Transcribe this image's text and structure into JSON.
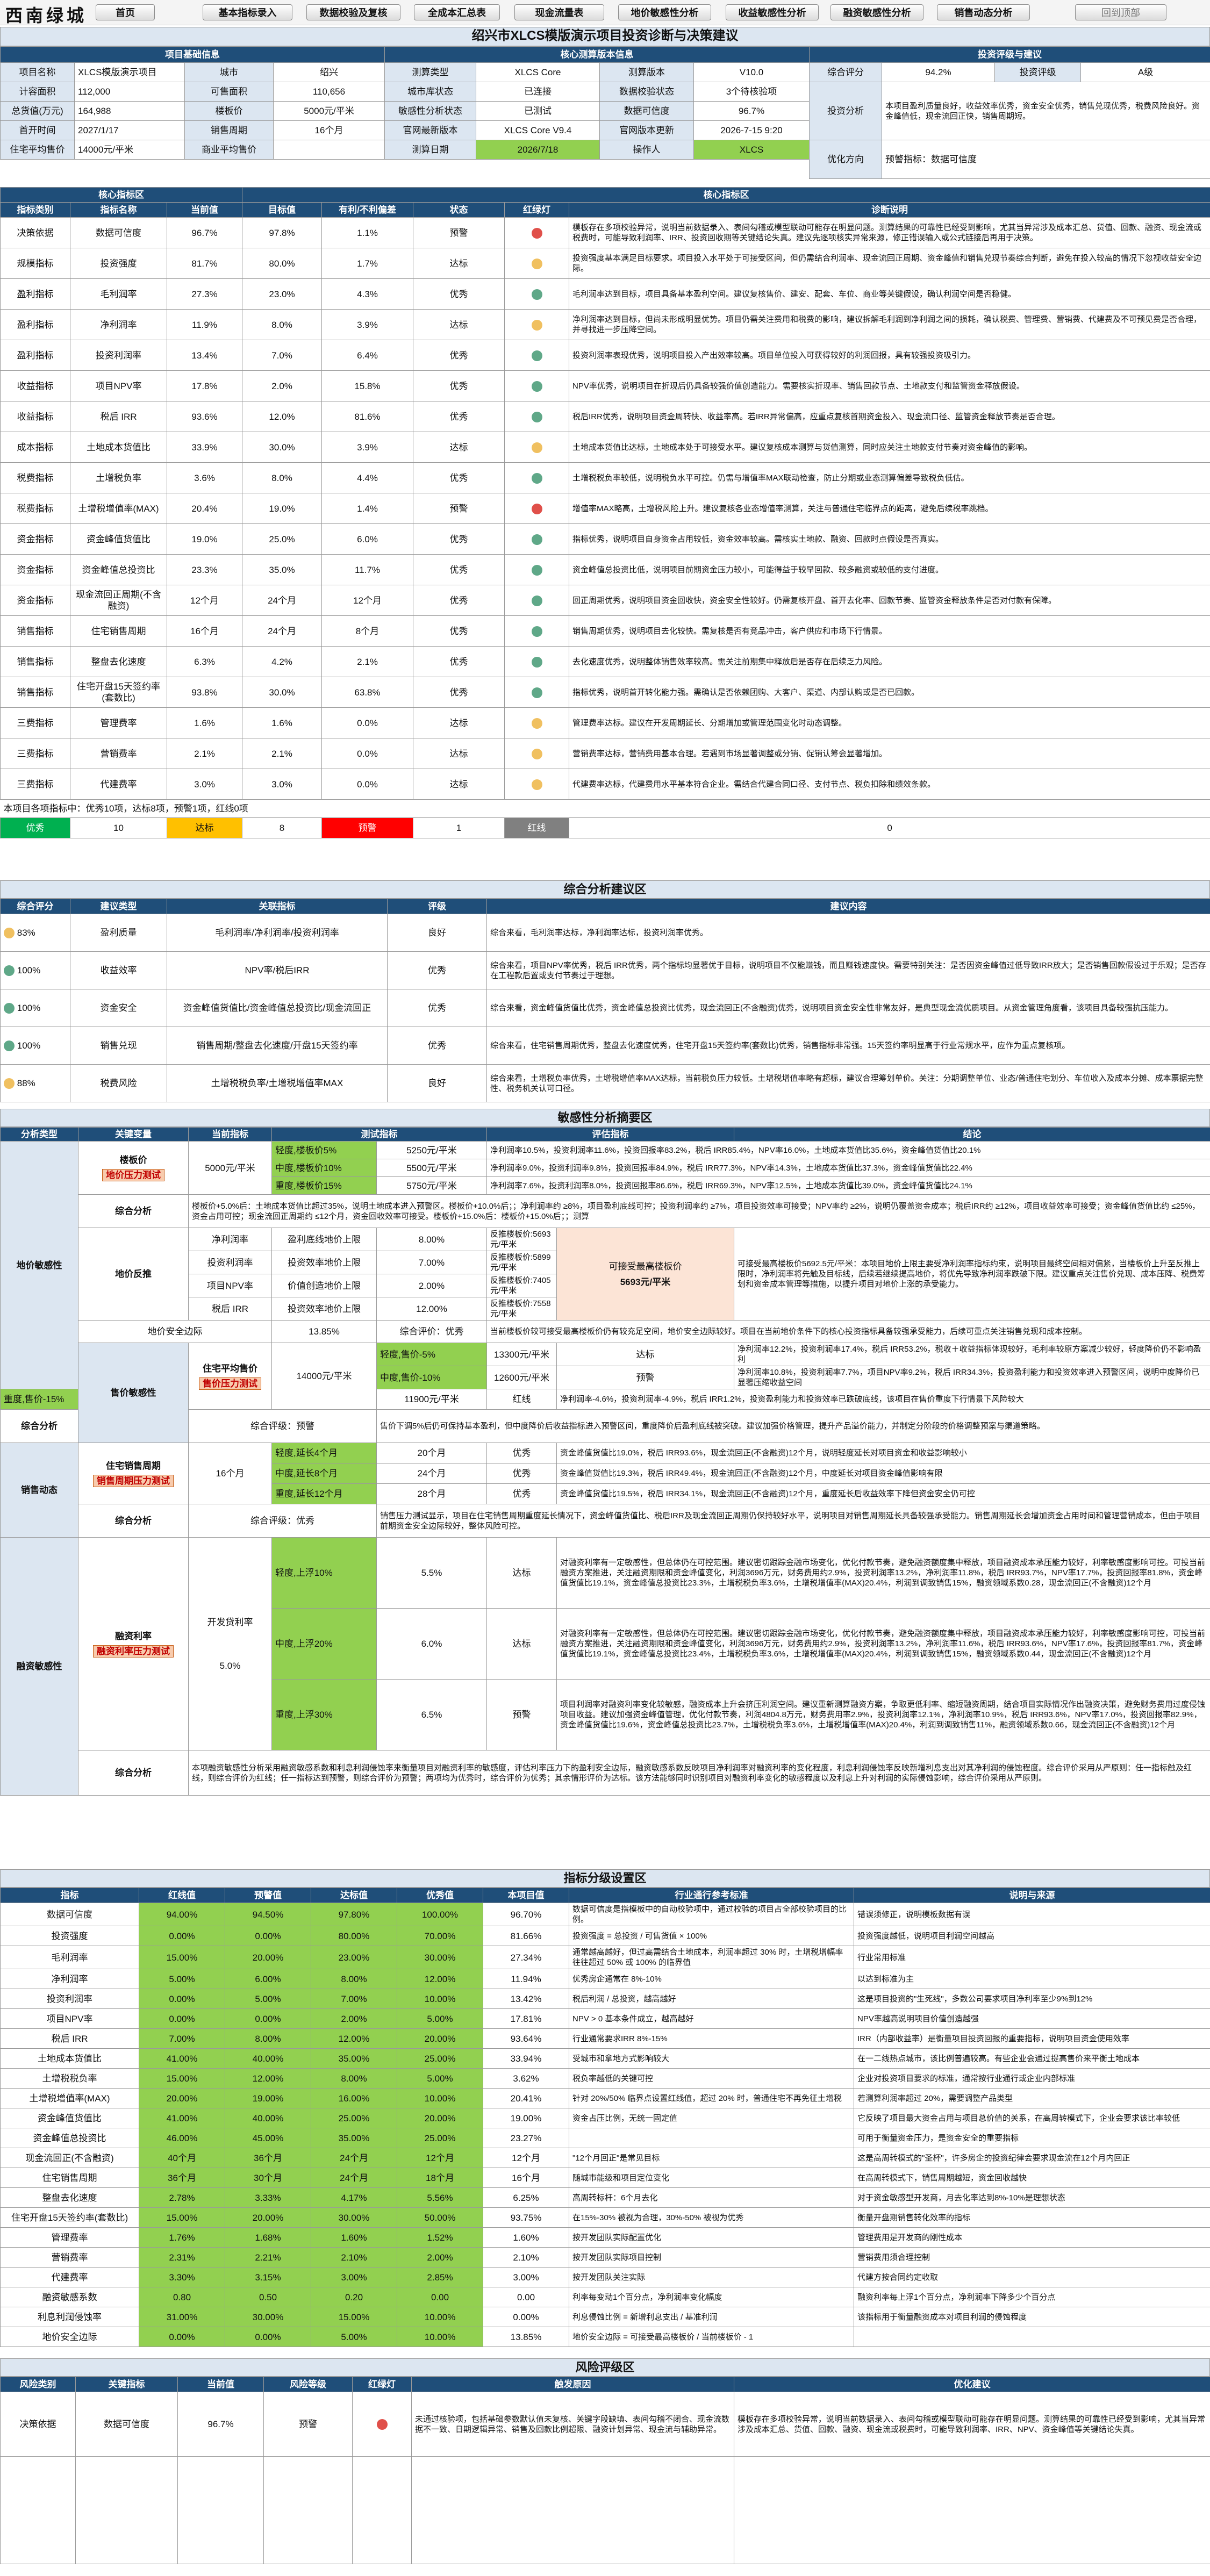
{
  "app": {
    "logo": "西南绿城"
  },
  "nav": [
    "首页",
    "基本指标录入",
    "数据校验及复核",
    "全成本汇总表",
    "现金流量表",
    "地价敏感性分析",
    "收益敏感性分析",
    "融资敏感性分析",
    "销售动态分析",
    "回到顶部"
  ],
  "title": "绍兴市XLCS模版演示项目投资诊断与决策建议",
  "basic": {
    "header": "项目基础信息",
    "rows": [
      [
        "项目名称",
        "XLCS模版演示项目",
        "城市",
        "绍兴"
      ],
      [
        "计容面积",
        "112,000",
        "可售面积",
        "110,656"
      ],
      [
        "总货值(万元)",
        "164,988",
        "楼板价",
        "5000元/平米"
      ],
      [
        "首开时间",
        "2027/1/17",
        "销售周期",
        "16个月"
      ],
      [
        "住宅平均售价",
        "14000元/平米",
        "商业平均售价",
        ""
      ]
    ]
  },
  "model": {
    "header": "核心测算版本信息",
    "rows": [
      [
        "测算类型",
        "XLCS Core",
        "测算版本",
        "V10.0"
      ],
      [
        "城市库状态",
        "已连接",
        "数据校验状态",
        "3个待核验项"
      ],
      [
        "敏感性分析状态",
        "已测试",
        "数据可信度",
        "96.7%"
      ],
      [
        "官网最新版本",
        "XLCS  Core V9.4",
        "官网版本更新",
        "2026-7-15  9:20"
      ],
      [
        "测算日期",
        "2026/7/18",
        "操作人",
        "XLCS"
      ]
    ]
  },
  "rating": {
    "header": "投资评级与建议",
    "score_label": "综合评分",
    "score": "94.2%",
    "grade_label": "投资评级",
    "grade": "A级",
    "analysis_label": "投资分析",
    "analysis": "本项目盈利质量良好，收益效率优秀，资金安全优秀，销售兑现优秀，税费风险良好。资金峰值低，现金流回正快，销售周期短。",
    "direction_label": "优化方向",
    "direction": "预警指标：数据可信度"
  },
  "core": {
    "header_left": "核心指标区",
    "header_mid": "核心指标区",
    "cols": [
      "指标类别",
      "指标名称",
      "当前值",
      "目标值",
      "有利/不利偏差",
      "状态",
      "红绿灯",
      "诊断说明"
    ],
    "rows": [
      {
        "cat": "决策依据",
        "name": "数据可信度",
        "cur": "96.7%",
        "tgt": "97.8%",
        "dev": "1.1%",
        "status": "预警",
        "light": "r",
        "note": "模板存在多项校验异常，说明当前数据录入、表间勾稽或模型联动可能存在明显问题。测算结果的可靠性已经受到影响，尤其当异常涉及成本汇总、货值、回款、融资、现金流或税费时，可能导致利润率、IRR、投资回收期等关键结论失真。建议先逐项核实异常来源，修正错误输入或公式链接后再用于决策。"
      },
      {
        "cat": "规模指标",
        "name": "投资强度",
        "cur": "81.7%",
        "tgt": "80.0%",
        "dev": "1.7%",
        "status": "达标",
        "light": "y",
        "note": "投资强度基本满足目标要求。项目投入水平处于可接受区间，但仍需结合利润率、现金流回正周期、资金峰值和销售兑现节奏综合判断，避免在投入较高的情况下忽视收益安全边际。"
      },
      {
        "cat": "盈利指标",
        "name": "毛利润率",
        "cur": "27.3%",
        "tgt": "23.0%",
        "dev": "4.3%",
        "status": "优秀",
        "light": "g",
        "note": "毛利润率达到目标，项目具备基本盈利空间。建议复核售价、建安、配套、车位、商业等关键假设，确认利润空间是否稳健。"
      },
      {
        "cat": "盈利指标",
        "name": "净利润率",
        "cur": "11.9%",
        "tgt": "8.0%",
        "dev": "3.9%",
        "status": "达标",
        "light": "y",
        "note": "净利润率达到目标，但尚未形成明显优势。项目仍需关注费用和税费的影响，建议拆解毛利润到净利润之间的损耗，确认税费、管理费、营销费、代建费及不可预见费是否合理，并寻找进一步压降空间。"
      },
      {
        "cat": "盈利指标",
        "name": "投资利润率",
        "cur": "13.4%",
        "tgt": "7.0%",
        "dev": "6.4%",
        "status": "优秀",
        "light": "g",
        "note": "投资利润率表现优秀，说明项目投入产出效率较高。项目单位投入可获得较好的利润回报，具有较强投资吸引力。"
      },
      {
        "cat": "收益指标",
        "name": "项目NPV率",
        "cur": "17.8%",
        "tgt": "2.0%",
        "dev": "15.8%",
        "status": "优秀",
        "light": "g",
        "note": "NPV率优秀，说明项目在折现后仍具备较强价值创造能力。需要核实折现率、销售回款节点、土地款支付和监管资金释放假设。"
      },
      {
        "cat": "收益指标",
        "name": "税后 IRR",
        "cur": "93.6%",
        "tgt": "12.0%",
        "dev": "81.6%",
        "status": "优秀",
        "light": "g",
        "note": "税后IRR优秀，说明项目资金周转快、收益率高。若IRR异常偏高，应重点复核首期资金投入、现金流口径、监管资金释放节奏是否合理。"
      },
      {
        "cat": "成本指标",
        "name": "土地成本货值比",
        "cur": "33.9%",
        "tgt": "30.0%",
        "dev": "3.9%",
        "status": "达标",
        "light": "y",
        "note": "土地成本货值比达标，土地成本处于可接受水平。建议复核成本测算与货值测算，同时应关注土地款支付节奏对资金峰值的影响。"
      },
      {
        "cat": "税费指标",
        "name": "土增税负率",
        "cur": "3.6%",
        "tgt": "8.0%",
        "dev": "4.4%",
        "status": "优秀",
        "light": "g",
        "note": "土增税税负率较低，说明税负水平可控。仍需与增值率MAX联动检查，防止分期或业态测算偏差导致税负低估。"
      },
      {
        "cat": "税费指标",
        "name": "土增税增值率(MAX)",
        "cur": "20.4%",
        "tgt": "19.0%",
        "dev": "1.4%",
        "status": "预警",
        "light": "r",
        "note": "增值率MAX略高，土增税风险上升。建议复核各业态增值率测算，关注与普通住宅临界点的距离，避免后续税率跳档。"
      },
      {
        "cat": "资金指标",
        "name": "资金峰值货值比",
        "cur": "19.0%",
        "tgt": "25.0%",
        "dev": "6.0%",
        "status": "优秀",
        "light": "g",
        "note": "指标优秀，说明项目自身资金占用较低，资金效率较高。需核实土地款、融资、回款时点假设是否真实。"
      },
      {
        "cat": "资金指标",
        "name": "资金峰值总投资比",
        "cur": "23.3%",
        "tgt": "35.0%",
        "dev": "11.7%",
        "status": "优秀",
        "light": "g",
        "note": "资金峰值总投资比低，说明项目前期资金压力较小，可能得益于较早回款、较多融资或较低的支付进度。"
      },
      {
        "cat": "资金指标",
        "name": "现金流回正周期(不含融资)",
        "cur": "12个月",
        "tgt": "24个月",
        "dev": "12个月",
        "status": "优秀",
        "light": "g",
        "note": "回正周期优秀，说明项目资金回收快，资金安全性较好。仍需复核开盘、首开去化率、回款节奏、监管资金释放条件是否对付款有保障。"
      },
      {
        "cat": "销售指标",
        "name": "住宅销售周期",
        "cur": "16个月",
        "tgt": "24个月",
        "dev": "8个月",
        "status": "优秀",
        "light": "g",
        "note": "销售周期优秀，说明项目去化较快。需复核是否有竞品冲击，客户供应和市场下行情景。"
      },
      {
        "cat": "销售指标",
        "name": "整盘去化速度",
        "cur": "6.3%",
        "tgt": "4.2%",
        "dev": "2.1%",
        "status": "优秀",
        "light": "g",
        "note": "去化速度优秀，说明整体销售效率较高。需关注前期集中释放后是否存在后续乏力风险。"
      },
      {
        "cat": "销售指标",
        "name": "住宅开盘15天签约率(套数比)",
        "cur": "93.8%",
        "tgt": "30.0%",
        "dev": "63.8%",
        "status": "优秀",
        "light": "g",
        "note": "指标优秀，说明首开转化能力强。需确认是否依赖团购、大客户、渠道、内部认购或是否已回款。"
      },
      {
        "cat": "三费指标",
        "name": "管理费率",
        "cur": "1.6%",
        "tgt": "1.6%",
        "dev": "0.0%",
        "status": "达标",
        "light": "y",
        "note": "管理费率达标。建议在开发周期延长、分期增加或管理范围变化时动态调整。"
      },
      {
        "cat": "三费指标",
        "name": "营销费率",
        "cur": "2.1%",
        "tgt": "2.1%",
        "dev": "0.0%",
        "status": "达标",
        "light": "y",
        "note": "营销费率达标，营销费用基本合理。若遇到市场显著调整或分销、促销认筹会显著增加。"
      },
      {
        "cat": "三费指标",
        "name": "代建费率",
        "cur": "3.0%",
        "tgt": "3.0%",
        "dev": "0.0%",
        "status": "达标",
        "light": "y",
        "note": "代建费率达标，代建费用水平基本符合企业。需结合代建合同口径、支付节点、税负扣除和绩效条款。"
      }
    ],
    "summary": "本项目各项指标中：优秀10项，达标8项，预警1项，红线0项",
    "legend": [
      [
        "优秀",
        "10"
      ],
      [
        "达标",
        "8"
      ],
      [
        "预警",
        "1"
      ],
      [
        "红线",
        "0"
      ]
    ]
  },
  "overall": {
    "header": "综合分析建议区",
    "cols": [
      "综合评分",
      "建议类型",
      "关联指标",
      "评级",
      "建议内容"
    ],
    "rows": [
      {
        "score": "83%",
        "light": "y",
        "type": "盈利质量",
        "ind": "毛利润率/净利润率/投资利润率",
        "lvl": "良好",
        "text": "综合来看，毛利润率达标，净利润率达标，投资利润率优秀。"
      },
      {
        "score": "100%",
        "light": "g",
        "type": "收益效率",
        "ind": "NPV率/税后IRR",
        "lvl": "优秀",
        "text": "综合来看，项目NPV率优秀，税后 IRR优秀，两个指标均显著优于目标，说明项目不仅能赚钱，而且赚钱速度快。需要特别关注：是否因资金峰值过低导致IRR放大；是否销售回款假设过于乐观；是否存在工程款后置或支付节奏过于理想。"
      },
      {
        "score": "100%",
        "light": "g",
        "type": "资金安全",
        "ind": "资金峰值货值比/资金峰值总投资比/现金流回正",
        "lvl": "优秀",
        "text": "综合来看，资金峰值货值比优秀，资金峰值总投资比优秀，现金流回正(不含融资)优秀，说明项目资金安全性非常友好，是典型现金流优质项目。从资金管理角度看，该项目具备较强抗压能力。"
      },
      {
        "score": "100%",
        "light": "g",
        "type": "销售兑现",
        "ind": "销售周期/整盘去化速度/开盘15天签约率",
        "lvl": "优秀",
        "text": "综合来看，住宅销售周期优秀，整盘去化速度优秀，住宅开盘15天签约率(套数比)优秀，销售指标非常强。15天签约率明显高于行业常规水平，应作为重点复核项。"
      },
      {
        "score": "88%",
        "light": "y",
        "type": "税费风险",
        "ind": "土增税税负率/土增税增值率MAX",
        "lvl": "良好",
        "text": "综合来看，土增税负率优秀，土增税增值率MAX达标，当前税负压力较低。土增税增值率略有超标，建议合理筹划单价。关注：分期调整单位、业态/普通住宅划分、车位收入及成本分摊、成本票据完整性、税务机关认可口径。"
      }
    ]
  },
  "sens": {
    "header": "敏感性分析摘要区",
    "cols": [
      "分析类型",
      "关键变量",
      "当前指标",
      "测试指标",
      "评估指标",
      "结论"
    ],
    "land": {
      "type": "地价敏感性",
      "var1": "楼板价",
      "tag1": "地价压力测试",
      "cur1": "5000元/平米",
      "tests": [
        {
          "t": "轻度,楼板价5%",
          "v": "5250元/平米",
          "r": "净利润率10.5%，投资利润率11.6%，投资回报率83.2%，税后 IRR85.4%，NPV率16.0%，土地成本货值比35.6%，资金峰值货值比20.1%"
        },
        {
          "t": "中度,楼板价10%",
          "v": "5500元/平米",
          "r": "净利润率9.0%，投资利润率9.8%，投资回报率84.9%，税后 IRR77.3%，NPV率14.3%，土地成本货值比37.3%，资金峰值货值比22.4%"
        },
        {
          "t": "重度,楼板价15%",
          "v": "5750元/平米",
          "r": "净利润率7.6%，投资利润率8.0%，投资回报率86.6%，税后 IRR69.3%，NPV率12.5%，土地成本货值比39.0%，资金峰值货值比24.1%"
        }
      ],
      "summary_label": "综合分析",
      "summary": "楼板价+5.0%后：土地成本货值比超过35%，说明土地成本进入预警区。楼板价+10.0%后；；净利润率约 ≥8%，项目盈利底线可控；投资利润率约 ≥7%，项目投资效率可接受；NPV率约 ≥2%，说明仍覆盖资金成本；税后IRR约 ≥12%，项目收益效率可接受；资金峰值货值比约 ≤25%，资金占用可控；现金流回正周期约 ≤12个月，资金回收效率可接受。楼板价+15.0%后：楼板价+15.0%后；；测算",
      "reverse_label": "地价反推",
      "rev_rows": [
        [
          "净利润率",
          "盈利底线地价上限",
          "8.00%",
          "反推楼板价:5693元/平米"
        ],
        [
          "投资利润率",
          "投资效率地价上限",
          "7.00%",
          "反推楼板价:5899元/平米"
        ],
        [
          "项目NPV率",
          "价值创造地价上限",
          "2.00%",
          "反推楼板价:7405元/平米"
        ],
        [
          "税后 IRR",
          "投资效率地价上限",
          "12.00%",
          "反推楼板价:7558元/平米"
        ]
      ],
      "max_label": "可接受最高楼板价",
      "max_value": "5693元/平米",
      "rev_note": "可接受最高楼板价5692.5元/平米：本项目地价上限主要受净利润率指标约束，说明项目最终空间相对偏紧，当楼板价上升至反推上限时，净利润率将先触及目标线，后续若继续提高地价，将优先导致净利润率跌破下限。建议重点关注售价兑现、成本压降、税费筹划和资金成本管理等措施，以提升项目对地价上涨的承受能力。",
      "safety_label": "地价安全边际",
      "safety": "13.85%",
      "safety_lvl": "综合评价：优秀",
      "safety_note": "当前楼板价较可接受最高楼板价仍有较充足空间，地价安全边际较好。项目在当前地价条件下的核心投资指标具备较强承受能力，后续可重点关注销售兑现和成本控制。"
    },
    "price": {
      "type": "售价敏感性",
      "var": "住宅平均售价",
      "tag": "售价压力测试",
      "cur": "14000元/平米",
      "tests": [
        {
          "t": "轻度,售价-5%",
          "v": "13300元/平米",
          "lvl": "达标",
          "r": "净利润率12.2%，投资利润率17.4%，税后 IRR53.2%，税收＋收益指标体现较好，毛利率较原方案减少较好，轻度降价仍不影响盈利"
        },
        {
          "t": "中度,售价-10%",
          "v": "12600元/平米",
          "lvl": "预警",
          "r": "净利润率10.8%，投资利润率7.7%，项目NPV率9.2%，税后 IRR34.3%，投资盈利能力和投资效率进入预警区间，说明中度降价已显著压缩收益空间"
        },
        {
          "t": "重度,售价-15%",
          "v": "11900元/平米",
          "lvl": "红线",
          "r": "净利润率-4.6%，投资利润率-4.9%，税后 IRR1.2%，投资盈利能力和投资效率已跌破底线，该项目在售价重度下行情景下风险较大"
        }
      ],
      "summary_label": "综合分析",
      "summary_lvl": "综合评级：预警",
      "summary": "售价下调5%后仍可保持基本盈利，但中度降价后收益指标进入预警区间，重度降价后盈利底线被突破。建议加强价格管理，提升产品溢价能力，并制定分阶段的价格调整预案与渠道策略。"
    },
    "sales": {
      "type": "销售动态",
      "var": "住宅销售周期",
      "tag": "销售周期压力测试",
      "cur": "16个月",
      "tests": [
        {
          "t": "轻度,延长4个月",
          "v": "20个月",
          "lvl": "优秀",
          "r": "资金峰值货值比19.0%，税后 IRR93.6%，现金流回正(不含融资)12个月，说明轻度延长对项目资金和收益影响较小"
        },
        {
          "t": "中度,延长8个月",
          "v": "24个月",
          "lvl": "优秀",
          "r": "资金峰值货值比19.3%，税后 IRR49.4%，现金流回正(不含融资)12个月，中度延长对项目资金峰值影响有限"
        },
        {
          "t": "重度,延长12个月",
          "v": "28个月",
          "lvl": "优秀",
          "r": "资金峰值货值比19.5%，税后 IRR34.1%，现金流回正(不含融资)12个月，重度延长后收益效率下降但资金安全仍可控"
        }
      ],
      "summary_label": "综合分析",
      "summary_lvl": "综合评级：优秀",
      "summary": "销售压力测试显示，项目在住宅销售周期重度延长情况下，资金峰值货值比、税后IRR及现金流回正周期仍保持较好水平，说明项目对销售周期延长具备较强承受能力。销售周期延长会增加资金占用时间和管理营销成本，但由于项目前期资金安全边际较好，整体风险可控。"
    },
    "fin": {
      "type": "融资敏感性",
      "var": "融资利率",
      "tag": "融资利率压力测试",
      "cur": "开发贷利率",
      "rate": "5.0%",
      "tests": [
        {
          "t": "轻度,上浮10%",
          "v": "5.5%",
          "lvl": "达标",
          "r": "对融资利率有一定敏感性，但总体仍在可控范围。建议密切跟踪金融市场变化，优化付款节奏，避免融资额度集中释放，项目融资成本承压能力较好，利率敏感度影响可控。可投当前融资方案推进，关注融资期限和资金峰值变化，利润3696万元，财务费用约2.9%，投资利润率13.2%，净利润率11.8%，税后 IRR93.7%，NPV率17.7%，投资回报率81.8%，资金峰值货值比19.1%，资金峰值总投资比23.3%，土增税税负率3.6%，土增税增值率(MAX)20.4%，利润到调致销售15%，融资领域系数0.28，现金流回正(不含融资)12个月"
        },
        {
          "t": "中度,上浮20%",
          "v": "6.0%",
          "lvl": "达标",
          "r": "对融资利率有一定敏感性，但总体仍在可控范围。建议密切跟踪金融市场变化，优化付款节奏，避免融资额度集中释放，项目融资成本承压能力较好，利率敏感度影响可控，可投当前融资方案推进，关注融资期限和资金峰值变化，利润3696万元，财务费用约2.9%，投资利润率13.2%，净利润率11.6%，税后 IRR93.6%，NPV率17.6%，投资回报率81.7%，资金峰值货值比19.1%，资金峰值总投资比23.4%，土增税税负率3.6%，土增税增值率(MAX)20.4%，利润到调致销售15%，融资领域系数0.44，现金流回正(不含融资)12个月"
        },
        {
          "t": "重度,上浮30%",
          "v": "6.5%",
          "lvl": "预警",
          "r": "项目利润率对融资利率变化较敏感，融资成本上升会挤压利润空间。建议重新测算融资方案，争取更低利率、缩短融资周期，结合项目实际情况作出融资决策，避免财务费用过度侵蚀项目收益。建议加强资金峰值管理，优化付款节奏，利润4804.8万元，财务费用率2.9%，投资利润率12.1%，净利润率10.9%，税后 IRR93.6%，NPV率17.0%，投资回报率82.9%，资金峰值货值比19.6%，资金峰值总投资比23.7%，土增税税负率3.6%，土增税增值率(MAX)20.4%，利润到调致销售11%，融资领域系数0.66，现金流回正(不含融资)12个月"
        }
      ],
      "summary_label": "综合分析",
      "summary": "本项融资敏感性分析采用融资敏感系数和利息利润侵蚀率来衡量项目对融资利率的敏感度，评估利率压力下的盈利安全边际，融资敏感系数反映项目净利润率对融资利率的变化程度，利息利润侵蚀率反映新增利息支出对其净利润的侵蚀程度。综合评价采用从严原则：任一指标触及红线，则综合评价为红线；任一指标达到预警，则综合评价为预警；两项均为优秀时，综合评价为优秀；其余情形评价为达标。该方法能够同时识别项目对融资利率变化的敏感程度以及利息上升对利润的实际侵蚀影响，综合评价采用从严原则。"
    }
  },
  "grade": {
    "header": "指标分级设置区",
    "cols": [
      "指标",
      "红线值",
      "预警值",
      "达标值",
      "优秀值",
      "本项目值",
      "行业通行参考标准",
      "说明与来源"
    ],
    "rows": [
      [
        "数据可信度",
        "94.00%",
        "94.50%",
        "97.80%",
        "100.00%",
        "96.70%",
        "数据可信度是指模板中的自动校验项中，通过校验的项目占全部校验项目的比例。",
        "错误须修正，说明模板数据有误"
      ],
      [
        "投资强度",
        "0.00%",
        "0.00%",
        "80.00%",
        "70.00%",
        "81.66%",
        "投资强度 = 总投资 / 可售货值 × 100%",
        "投资强度越低，说明项目利润空间越高"
      ],
      [
        "毛利润率",
        "15.00%",
        "20.00%",
        "23.00%",
        "30.00%",
        "27.34%",
        "通常越高越好，但过高需结合土地成本，利润率超过 30% 时，土增税增幅率往往超过 50% 或 100% 的临界值",
        "行业常用标准"
      ],
      [
        "净利润率",
        "5.00%",
        "6.00%",
        "8.00%",
        "12.00%",
        "11.94%",
        "优秀房企通常在 8%-10%",
        "以达到标准为主"
      ],
      [
        "投资利润率",
        "0.00%",
        "5.00%",
        "7.00%",
        "10.00%",
        "13.42%",
        "税后利润 / 总投资，越高越好",
        "这是项目投资的\"生死线\"，多数公司要求项目净利率至少9%到12%"
      ],
      [
        "项目NPV率",
        "0.00%",
        "0.00%",
        "2.00%",
        "5.00%",
        "17.81%",
        "NPV > 0 基本条件成立，越高越好",
        "NPV率越高说明项目价值创造越强"
      ],
      [
        "税后 IRR",
        "7.00%",
        "8.00%",
        "12.00%",
        "20.00%",
        "93.64%",
        "行业通常要求IRR 8%-15%",
        "IRR（内部收益率）是衡量项目投资回报的重要指标，说明项目资金使用效率"
      ],
      [
        "土地成本货值比",
        "41.00%",
        "40.00%",
        "35.00%",
        "25.00%",
        "33.94%",
        "受城市和拿地方式影响较大",
        "在一二线热点城市，该比例普遍较高。有些企业会通过提高售价来平衡土地成本"
      ],
      [
        "土增税税负率",
        "15.00%",
        "12.00%",
        "8.00%",
        "5.00%",
        "3.62%",
        "税负率越低的关键可控",
        "企业对投资项目要求的标准，通常按行业通行或企业内部标准"
      ],
      [
        "土增税增值率(MAX)",
        "20.00%",
        "19.00%",
        "16.00%",
        "10.00%",
        "20.41%",
        "针对 20%/50% 临界点设置红线值，超过 20% 时，普通住宅不再免征土增税",
        "若测算利润率超过 20%，需要调整产品类型"
      ],
      [
        "资金峰值货值比",
        "41.00%",
        "40.00%",
        "25.00%",
        "20.00%",
        "19.00%",
        "资金占压比例，无统一固定值",
        "它反映了项目最大资金占用与项目总价值的关系，在高周转模式下，企业会要求该比率较低"
      ],
      [
        "资金峰值总投资比",
        "46.00%",
        "45.00%",
        "35.00%",
        "25.00%",
        "23.27%",
        "",
        "可用于衡量资金压力，是资金安全的重要指标"
      ],
      [
        "现金流回正(不含融资)",
        "40个月",
        "36个月",
        "24个月",
        "12个月",
        "12个月",
        "\"12个月回正\"是常见目标",
        "这是高周转模式的\"圣杯\"，许多房企的投资纪律会要求现金流在12个月内回正"
      ],
      [
        "住宅销售周期",
        "36个月",
        "30个月",
        "24个月",
        "18个月",
        "16个月",
        "随城市能级和项目定位变化",
        "在高周转模式下，销售周期越短，资金回收越快"
      ],
      [
        "整盘去化速度",
        "2.78%",
        "3.33%",
        "4.17%",
        "5.56%",
        "6.25%",
        "高周转标杆：6个月去化",
        "对于资金敏感型开发商，月去化率达到8%-10%是理想状态"
      ],
      [
        "住宅开盘15天签约率(套数比)",
        "15.00%",
        "20.00%",
        "30.00%",
        "50.00%",
        "93.75%",
        "在15%-30% 被视为合理，30%-50% 被视为优秀",
        "衡量开盘期销售转化效率的指标"
      ],
      [
        "管理费率",
        "1.76%",
        "1.68%",
        "1.60%",
        "1.52%",
        "1.60%",
        "按开发团队实际配置优化",
        "管理费用是开发商的刚性成本"
      ],
      [
        "营销费率",
        "2.31%",
        "2.21%",
        "2.10%",
        "2.00%",
        "2.10%",
        "按开发团队实际项目控制",
        "营销费用须合理控制"
      ],
      [
        "代建费率",
        "3.30%",
        "3.15%",
        "3.00%",
        "2.85%",
        "3.00%",
        "按开发团队关注实际",
        "代建方按合同约定收取"
      ],
      [
        "融资敏感系数",
        "0.80",
        "0.50",
        "0.20",
        "0.00",
        "0.00",
        "利率每变动1个百分点，净利润率变化幅度",
        "融资利率每上浮1个百分点，净利润率下降多少个百分点"
      ],
      [
        "利息利润侵蚀率",
        "31.00%",
        "30.00%",
        "15.00%",
        "10.00%",
        "0.00%",
        "利息侵蚀比例 = 新增利息支出 / 基准利润",
        "该指标用于衡量融资成本对项目利润的侵蚀程度"
      ],
      [
        "地价安全边际",
        "0.00%",
        "0.00%",
        "5.00%",
        "10.00%",
        "13.85%",
        "地价安全边际 = 可接受最高楼板价 / 当前楼板价 - 1",
        ""
      ]
    ]
  },
  "risk": {
    "header": "风险评级区",
    "cols": [
      "风险类别",
      "关键指标",
      "当前值",
      "风险等级",
      "红绿灯",
      "触发原因",
      "优化建议"
    ],
    "rows": [
      {
        "cat": "决策依据",
        "ind": "数据可信度",
        "cur": "96.7%",
        "lvl": "预警",
        "light": "r",
        "reason": "未通过核验项，包括基础参数默认值未复核、关键字段缺填、表间勾稽不闭合、现金流数据不一致、日期逻辑异常、销售及回款比例超限、融资计划异常、现金流与辅助异常。",
        "advice": "模板存在多项校验异常，说明当前数据录入、表间勾稽或模型联动可能存在明显问题。测算结果的可靠性已经受到影响，尤其当异常涉及成本汇总、货值、回款、融资、现金流或税费时，可能导致利润率、IRR、NPV、资金峰值等关键结论失真。"
      }
    ]
  }
}
